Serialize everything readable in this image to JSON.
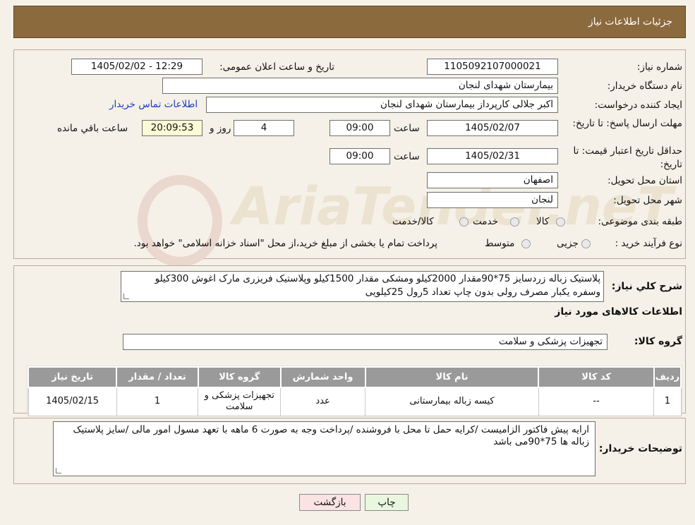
{
  "header": {
    "title": "جزئیات اطلاعات نیاز"
  },
  "need_info": {
    "need_number_label": "شماره نیاز:",
    "need_number": "1105092107000021",
    "announce_label": "تاریخ و ساعت اعلان عمومی:",
    "announce_value": "1405/02/02 - 12:29",
    "buyer_org_label": "نام دستگاه خریدار:",
    "buyer_org": "بیمارستان شهدای لنجان",
    "creator_label": "ایجاد کننده درخواست:",
    "creator": "اکبر جلالی کارپرداز بیمارستان شهدای لنجان",
    "contact_link": "اطلاعات تماس خریدار",
    "deadline_label": "مهلت ارسال پاسخ: تا تاریخ:",
    "deadline_date": "1405/02/07",
    "time_word": "ساعت",
    "deadline_time": "09:00",
    "days_value": "4",
    "days_word": "روز و",
    "remaining_time": "20:09:53",
    "remaining_word": "ساعت باقي مانده",
    "price_validity_label": "حداقل تاریخ اعتبار قیمت: تا تاریخ:",
    "price_validity_date": "1405/02/31",
    "price_validity_time": "09:00",
    "province_label": "استان محل تحویل:",
    "province": "اصفهان",
    "city_label": "شهر محل تحویل:",
    "city": "لنجان",
    "category_label": "طبقه بندی موضوعی:",
    "category_options": [
      "کالا",
      "خدمت",
      "کالا/خدمت"
    ],
    "purchase_type_label": "نوع فرآیند خرید :",
    "purchase_options": [
      "جزیی",
      "متوسط"
    ],
    "purchase_note": "پرداخت تمام یا بخشی از مبلغ خرید،از محل \"اسناد خزانه اسلامی\" خواهد بود."
  },
  "watermark": {
    "text": "AriaTender.neT"
  },
  "description": {
    "label": "شرح کلي نياز:",
    "line1": "پلاستیک زباله زردسایز 75*90مقدار 2000کیلو ومشکی مقدار 1500کیلو وپلاستیک فریزری مارک اغوش 300کیلو",
    "line2": "وسفره یکبار مصرف   رولی بدون چاپ تعداد 5رول 25کیلویی"
  },
  "goods": {
    "section_title": "اطلاعات کالاهای مورد نیاز",
    "group_label": "گروه کالا:",
    "group_value": "تجهیزات پزشکی و سلامت",
    "columns": [
      "ردیف",
      "کد کالا",
      "نام کالا",
      "واحد شمارش",
      "گروه کالا",
      "تعداد / مقدار",
      "تاریخ نیاز"
    ],
    "rows": [
      [
        "1",
        "--",
        "کیسه زباله بیمارستانی",
        "عدد",
        "تجهیزات پزشکی و سلامت",
        "1",
        "1405/02/15"
      ]
    ]
  },
  "buyer_notes": {
    "label": "توضیحات خریدار:",
    "text": "ارایه پیش فاکتور الزامیست /کرایه حمل تا محل با فروشنده /پرداخت وجه به صورت 6 ماهه با تعهد مسول امور مالی /سایز پلاستیک زباله ها 75*90می باشد"
  },
  "buttons": {
    "print": "چاپ",
    "back": "بازگشت"
  },
  "colors": {
    "header": "#8b6a3e",
    "background": "#f5f1e8",
    "link": "#1f3cc6",
    "print_btn": "#e9f7df",
    "back_btn": "#fbe3e3"
  }
}
